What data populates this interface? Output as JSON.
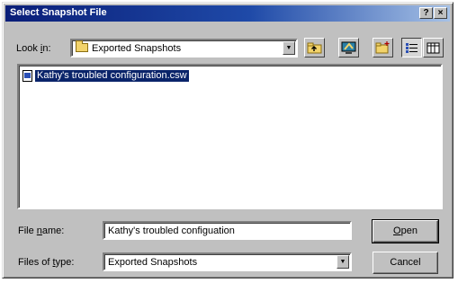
{
  "window": {
    "title": "Select Snapshot File",
    "help_label": "?",
    "close_label": "×"
  },
  "look_in": {
    "label_prefix": "Look ",
    "label_hotkey": "i",
    "label_suffix": "n:",
    "value": "Exported Snapshots"
  },
  "toolbar": {
    "icons": [
      "up-one-level-icon",
      "desktop-icon",
      "new-folder-icon",
      "list-view-icon",
      "details-view-icon"
    ]
  },
  "files": [
    {
      "name": "Kathy's troubled configuration.csw",
      "selected": true
    }
  ],
  "file_name": {
    "label_prefix": "File ",
    "label_hotkey": "n",
    "label_suffix": "ame:",
    "value": "Kathy's troubled configuation"
  },
  "file_type": {
    "label_prefix": "Files of ",
    "label_hotkey": "t",
    "label_suffix": "ype:",
    "value": "Exported Snapshots"
  },
  "buttons": {
    "open_hotkey": "O",
    "open_rest": "pen",
    "cancel": "Cancel"
  },
  "colors": {
    "titlebar_start": "#0a1e78",
    "selection": "#0a246a",
    "face": "#c0c0c0"
  }
}
